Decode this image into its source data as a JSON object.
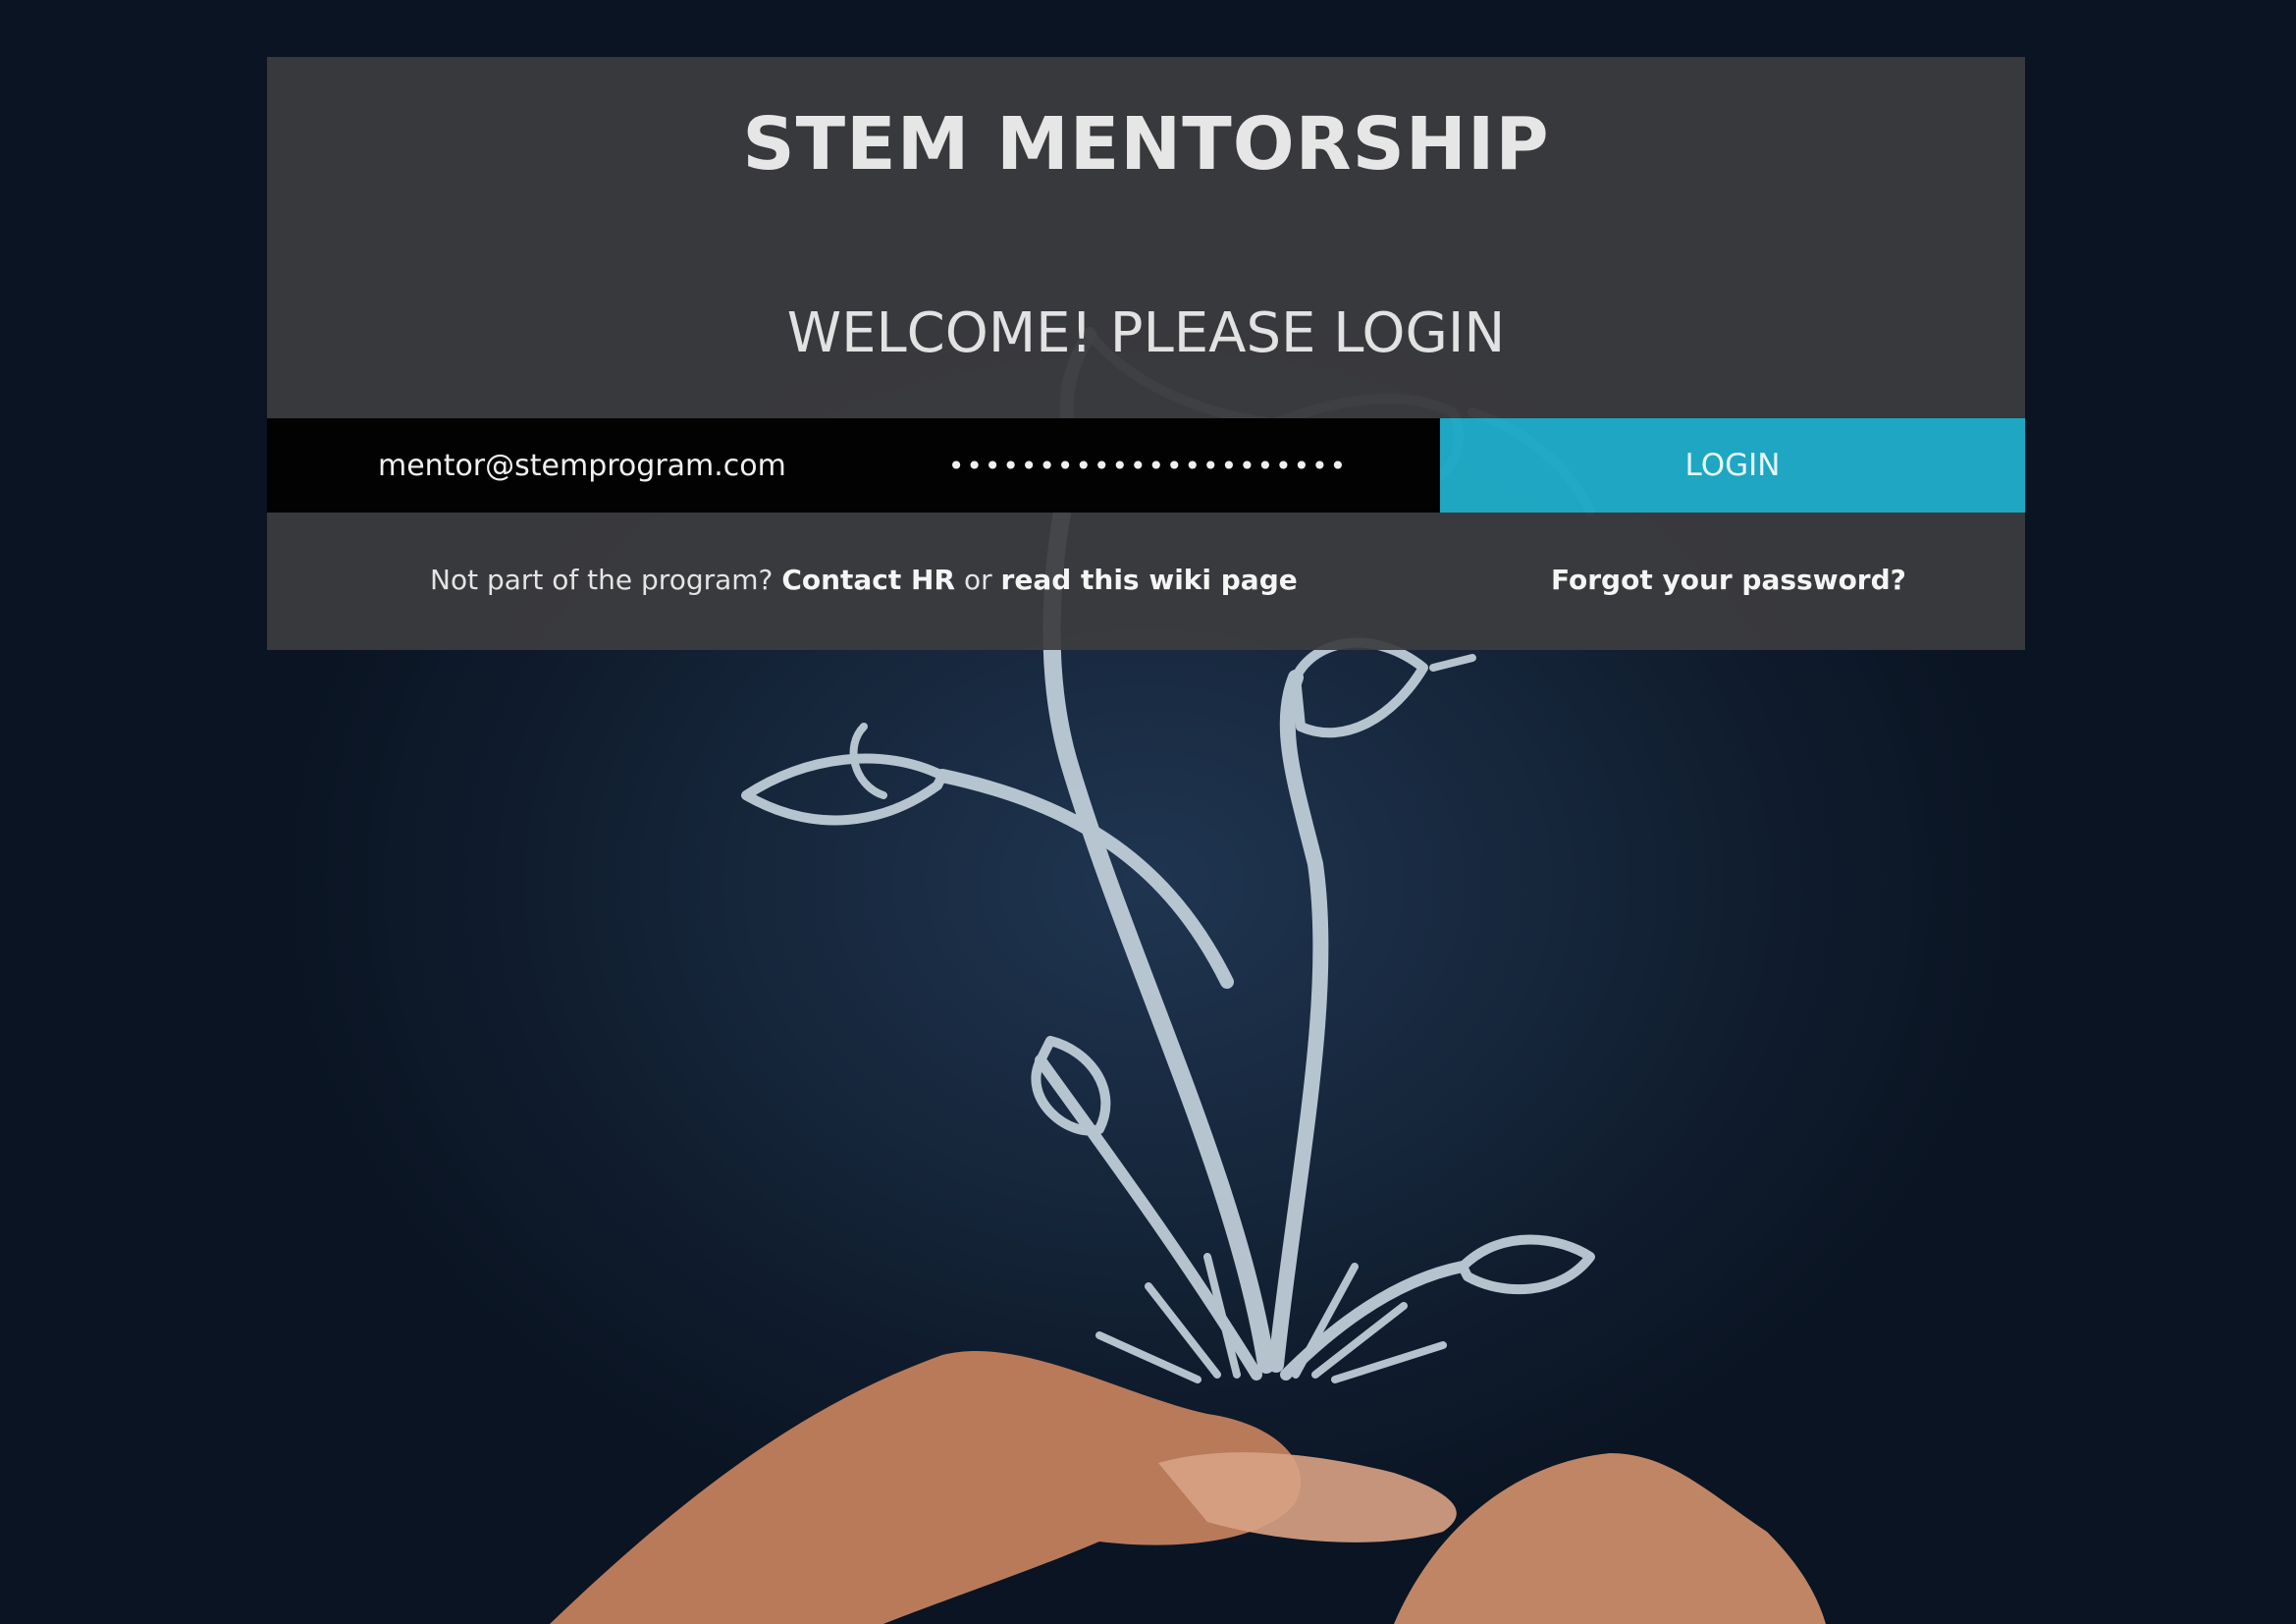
{
  "app": {
    "title": "STEM MENTORSHIP",
    "heading": "WELCOME! PLEASE LOGIN"
  },
  "login_form": {
    "email_value": "mentor@stemprogram.com",
    "password_masked": "••••••••••••••••••••••",
    "login_label": "LOGIN"
  },
  "help": {
    "prefix": "Not part of the program?",
    "contact_link": "Contact HR",
    "or_text": "or",
    "wiki_link": "read this wiki page",
    "forgot_link": "Forgot your password?"
  },
  "colors": {
    "panel": "#3c3c3e",
    "field_bg": "#020203",
    "accent": "#20abc7",
    "background": "#16263b"
  },
  "background_image": {
    "icon": "chalk-plant-in-hands-illustration"
  }
}
